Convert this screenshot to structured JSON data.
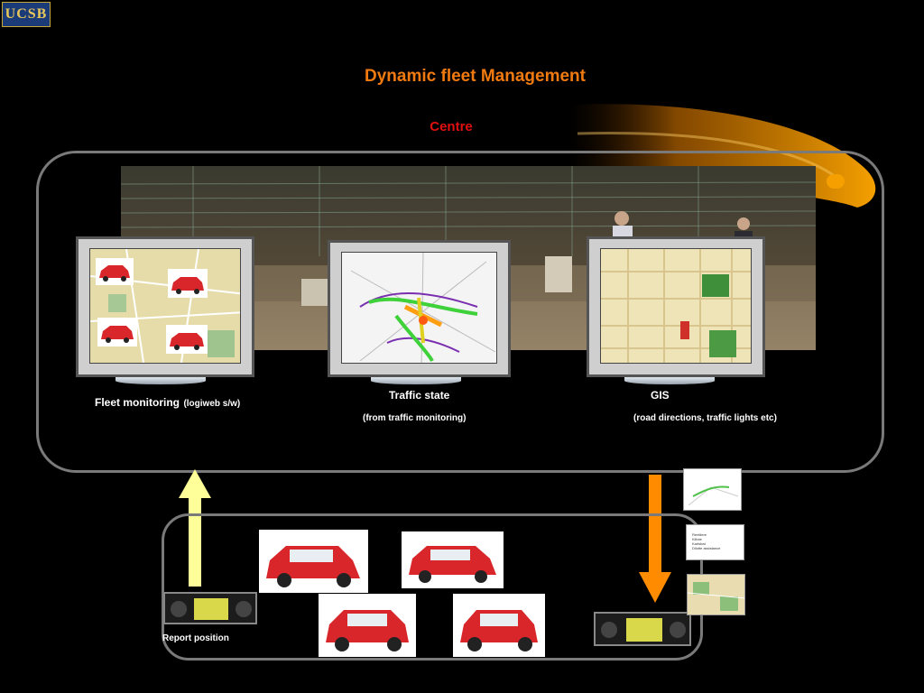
{
  "logo": {
    "text": "UCSB"
  },
  "slide": {
    "title": "Dynamic fleet Management",
    "centre": "Centre"
  },
  "monitors": {
    "fleet": {
      "label": "Fleet monitoring",
      "sub": "(logiweb s/w)"
    },
    "traffic": {
      "label": "Traffic state",
      "sub": "(from traffic monitoring)"
    },
    "gis": {
      "label": "GIS",
      "sub": "(road directions, traffic lights etc)"
    }
  },
  "vehicles": {
    "report_label": "Report position"
  },
  "colors": {
    "title": "#f07a10",
    "centre": "#e01010",
    "up_arrow": "#ffff99",
    "down_arrow": "#ff8c00",
    "panel_border": "#7a7a7a",
    "swoosh": "#f5a000"
  },
  "icons": {
    "up_arrow": "arrow-up-icon",
    "down_arrow": "arrow-down-icon",
    "car": "car-icon",
    "navigation_device": "navigation-device-icon"
  },
  "legend_thumb": {
    "lines": [
      "Rentliere",
      "Kiliote",
      "Karlsbat",
      "Dilotte assistance"
    ]
  }
}
